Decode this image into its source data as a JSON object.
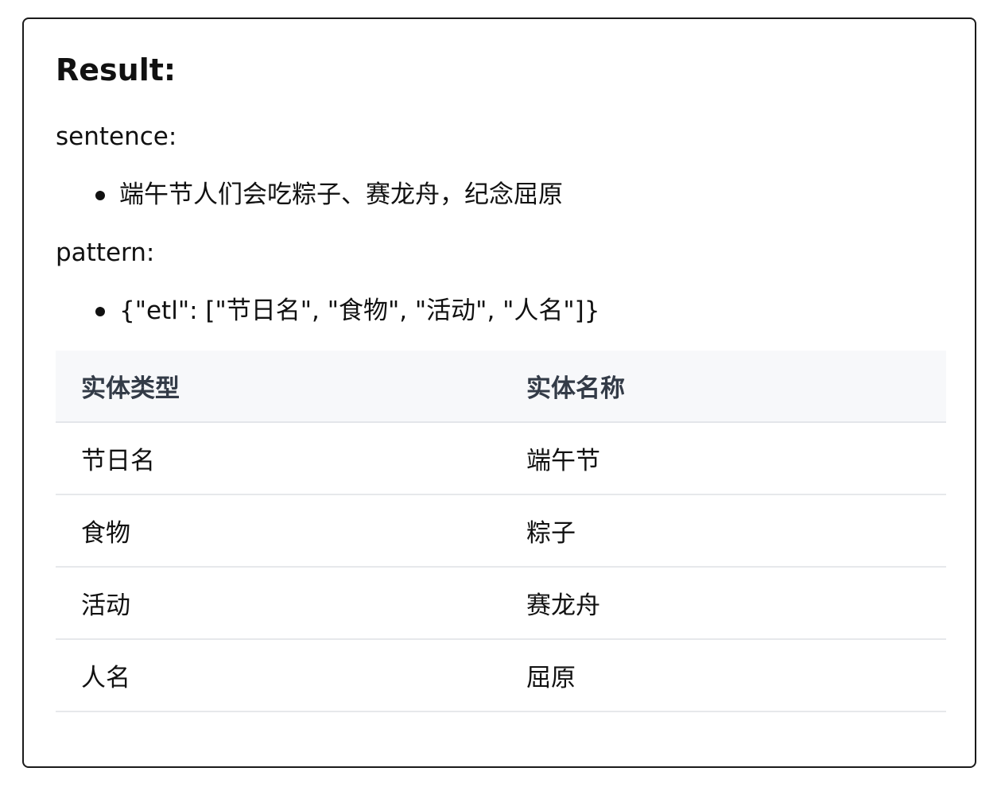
{
  "result": {
    "title": "Result:",
    "sentence_label": "sentence:",
    "sentences": [
      "端午节人们会吃粽子、赛龙舟，纪念屈原"
    ],
    "pattern_label": "pattern:",
    "patterns": [
      "{\"etl\": [\"节日名\", \"食物\", \"活动\", \"人名\"]}"
    ]
  },
  "table": {
    "headers": [
      "实体类型",
      "实体名称"
    ],
    "rows": [
      [
        "节日名",
        "端午节"
      ],
      [
        "食物",
        "粽子"
      ],
      [
        "活动",
        "赛龙舟"
      ],
      [
        "人名",
        "屈原"
      ]
    ]
  },
  "colors": {
    "border": "#1a1a1a",
    "header_bg": "#f7f8fa",
    "header_text": "#333b47",
    "row_divider": "#e6e8eb"
  }
}
